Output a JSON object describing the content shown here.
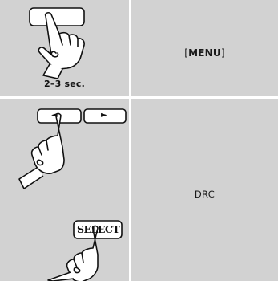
{
  "step1": {
    "caption": "2–3 sec.",
    "action_prefix": "[",
    "action_label": "MENU",
    "action_suffix": "]"
  },
  "step2": {
    "left_arrow": "◄",
    "right_arrow": "►",
    "select_label": "SELECT",
    "action_label": "DRC"
  }
}
